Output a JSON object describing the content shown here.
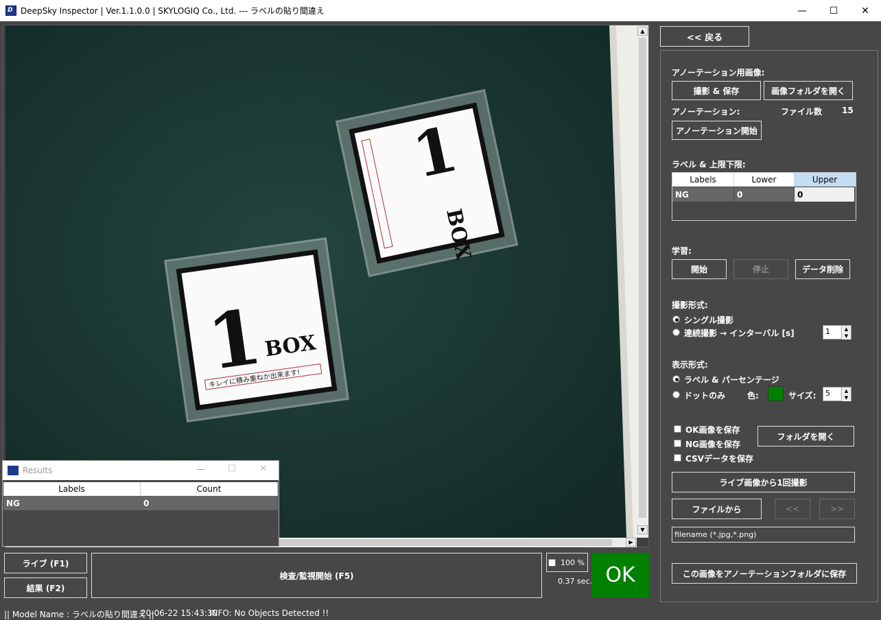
{
  "window": {
    "title": "DeepSky Inspector | Ver.1.1.0.0 | SKYLOGIQ Co., Ltd. --- ラベルの貼り間違え",
    "minimize": "—",
    "maximize": "☐",
    "close": "✕"
  },
  "right": {
    "back_label": "<< 戻る",
    "annotation_image_heading": "アノーテーション用画像:",
    "capture_save_label": "撮影 & 保存",
    "open_image_folder_label": "画像フォルダを開く",
    "annotation_heading": "アノーテーション:",
    "file_count_label": "ファイル数",
    "file_count_value": "15",
    "start_annotation_label": "アノーテーション開始",
    "label_limits_heading": "ラベル & 上限下限:",
    "label_table": {
      "headers": [
        "Labels",
        "Lower",
        "Upper"
      ],
      "rows": [
        [
          "NG",
          "0",
          "0"
        ]
      ]
    },
    "learning_heading": "学習:",
    "learn_start_label": "開始",
    "learn_stop_label": "停止",
    "delete_data_label": "データ削除",
    "capture_mode_heading": "撮影形式:",
    "capture_single_label": "シングル撮影",
    "capture_continuous_label": "連続撮影 → インターバル [s]",
    "interval_value": "1",
    "display_mode_heading": "表示形式:",
    "display_label_percent": "ラベル & パーセンテージ",
    "display_dot_only": "ドットのみ",
    "color_label": "色:",
    "dot_color": "#008000",
    "size_label": "サイズ:",
    "size_value": "5",
    "save_ok_label": "OK画像を保存",
    "save_ng_label": "NG画像を保存",
    "save_csv_label": "CSVデータを保存",
    "open_folder_label": "フォルダを開く",
    "capture_from_live_label": "ライブ画像から1回撮影",
    "from_file_label": "ファイルから",
    "prev_label": "<<",
    "next_label": ">>",
    "filename_placeholder": "filename (*.jpg,*.png)",
    "save_to_annotation_label": "この画像をアノーテーションフォルダに保存"
  },
  "results": {
    "title": "Results",
    "headers": [
      "Labels",
      "Count"
    ],
    "rows": [
      [
        "NG",
        "0"
      ]
    ]
  },
  "bottom": {
    "live_label": "ライブ (F1)",
    "result_label": "結果 (F2)",
    "inspect_label": "検査/監視開始 (F5)",
    "zoom_label": "100 %",
    "time_label": "0.37 sec.",
    "ok_label": "OK"
  },
  "status": {
    "model": "|| Model Name : ラベルの貼り間違え ||",
    "datetime": "20-06-22 15:43:30",
    "info": "INFO:   No Objects Detected !!"
  },
  "image": {
    "box_numeral": "1",
    "box_word": "BOX",
    "box_caption": "キレイに積み重ねか出来ます!"
  },
  "colors": {
    "ok_green": "#008000",
    "panel_bg": "#474747",
    "image_bg": "#1c3b36"
  }
}
